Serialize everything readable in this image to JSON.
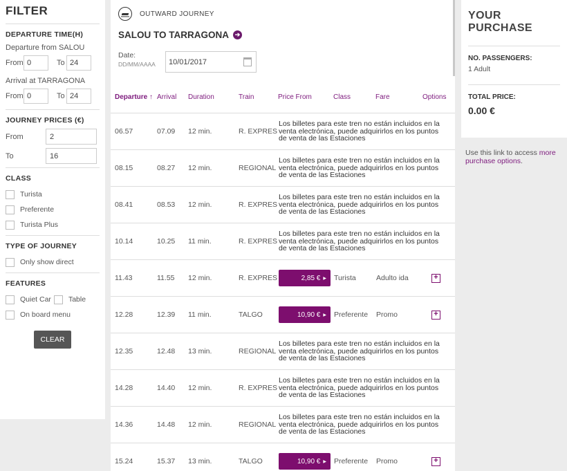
{
  "filter": {
    "title": "FILTER",
    "departure_time": {
      "heading": "DEPARTURE TIME(H)",
      "from_label": "Departure from SALOU",
      "from_from": "0",
      "from_to": "24",
      "arrival_label": "Arrival at TARRAGONA",
      "arr_from": "0",
      "arr_to": "24",
      "from_word": "From",
      "to_word": "To"
    },
    "prices": {
      "heading": "JOURNEY PRICES (€)",
      "from_label": "From",
      "from_value": "2",
      "to_label": "To",
      "to_value": "16"
    },
    "class": {
      "heading": "CLASS",
      "options": [
        "Turista",
        "Preferente",
        "Turista Plus"
      ]
    },
    "type": {
      "heading": "TYPE OF JOURNEY",
      "option": "Only show direct"
    },
    "features": {
      "heading": "FEATURES",
      "quiet_car": "Quiet Car",
      "table": "Table",
      "onboard": "On board menu"
    },
    "clear_label": "CLEAR"
  },
  "journey": {
    "outward_label": "OUTWARD JOURNEY",
    "route": "SALOU TO TARRAGONA",
    "date_label": "Date:",
    "date_format": "DD/MM/AAAA",
    "date_value": "10/01/2017",
    "headers": {
      "departure": "Departure ↑",
      "arrival": "Arrival",
      "duration": "Duration",
      "train": "Train",
      "price": "Price From",
      "class": "Class",
      "fare": "Fare",
      "options": "Options"
    },
    "rows": [
      {
        "dep": "06.57",
        "arr": "07.09",
        "dur": "12 min.",
        "train": "R. EXPRES",
        "note": "Los billetes para este tren no están incluidos en la venta electrónica, puede adquirirlos en los puntos de venta de las Estaciones"
      },
      {
        "dep": "08.15",
        "arr": "08.27",
        "dur": "12 min.",
        "train": "REGIONAL",
        "note": "Los billetes para este tren no están incluidos en la venta electrónica, puede adquirirlos en los puntos de venta de las Estaciones"
      },
      {
        "dep": "08.41",
        "arr": "08.53",
        "dur": "12 min.",
        "train": "R. EXPRES",
        "note": "Los billetes para este tren no están incluidos en la venta electrónica, puede adquirirlos en los puntos de venta de las Estaciones"
      },
      {
        "dep": "10.14",
        "arr": "10.25",
        "dur": "11 min.",
        "train": "R. EXPRES",
        "note": "Los billetes para este tren no están incluidos en la venta electrónica, puede adquirirlos en los puntos de venta de las Estaciones"
      },
      {
        "dep": "11.43",
        "arr": "11.55",
        "dur": "12 min.",
        "train": "R. EXPRES",
        "price": "2,85 €",
        "class": "Turista",
        "fare": "Adulto ida"
      },
      {
        "dep": "12.28",
        "arr": "12.39",
        "dur": "11 min.",
        "train": "TALGO",
        "price": "10,90 €",
        "class": "Preferente",
        "fare": "Promo"
      },
      {
        "dep": "12.35",
        "arr": "12.48",
        "dur": "13 min.",
        "train": "REGIONAL",
        "note": "Los billetes para este tren no están incluidos en la venta electrónica, puede adquirirlos en los puntos de venta de las Estaciones"
      },
      {
        "dep": "14.28",
        "arr": "14.40",
        "dur": "12 min.",
        "train": "R. EXPRES",
        "note": "Los billetes para este tren no están incluidos en la venta electrónica, puede adquirirlos en los puntos de venta de las Estaciones"
      },
      {
        "dep": "14.36",
        "arr": "14.48",
        "dur": "12 min.",
        "train": "REGIONAL",
        "note": "Los billetes para este tren no están incluidos en la venta electrónica, puede adquirirlos en los puntos de venta de las Estaciones"
      },
      {
        "dep": "15.24",
        "arr": "15.37",
        "dur": "13 min.",
        "train": "TALGO",
        "price": "10,90 €",
        "class": "Preferente",
        "fare": "Promo"
      }
    ]
  },
  "purchase": {
    "title": "YOUR PURCHASE",
    "passengers_label": "NO. PASSENGERS:",
    "passengers_value": "1 Adult",
    "total_label": "TOTAL PRICE:",
    "total_value": "0.00 €",
    "link_prefix": "Use this link to access ",
    "link_text": "more purchase options",
    "link_suffix": "."
  },
  "colors": {
    "accent": "#7d0e6e",
    "clear_button": "#555555"
  }
}
